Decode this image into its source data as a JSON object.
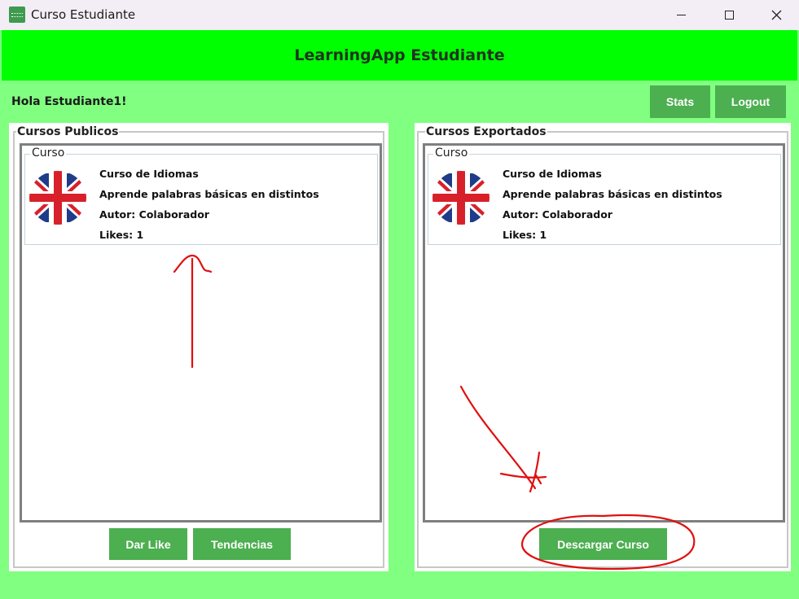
{
  "window": {
    "title": "Curso Estudiante"
  },
  "header": {
    "title": "LearningApp Estudiante"
  },
  "topbar": {
    "greeting": "Hola Estudiante1!",
    "stats_label": "Stats",
    "logout_label": "Logout"
  },
  "public_courses": {
    "group_label": "Cursos Publicos",
    "card_label": "Curso",
    "course": {
      "title": "Curso de Idiomas",
      "description": "Aprende palabras básicas en distintos",
      "author": "Autor: Colaborador",
      "likes": "Likes: 1",
      "image": "uk-flag-icon"
    },
    "like_button": "Dar Like",
    "trends_button": "Tendencias"
  },
  "exported_courses": {
    "group_label": "Cursos Exportados",
    "card_label": "Curso",
    "course": {
      "title": "Curso de Idiomas",
      "description": "Aprende palabras básicas en distintos",
      "author": "Autor: Colaborador",
      "likes": "Likes: 1",
      "image": "uk-flag-icon"
    },
    "download_button": "Descargar Curso"
  },
  "colors": {
    "background": "#80ff80",
    "header": "#00ff00",
    "button": "#4caf50",
    "annotation": "#e01010"
  }
}
